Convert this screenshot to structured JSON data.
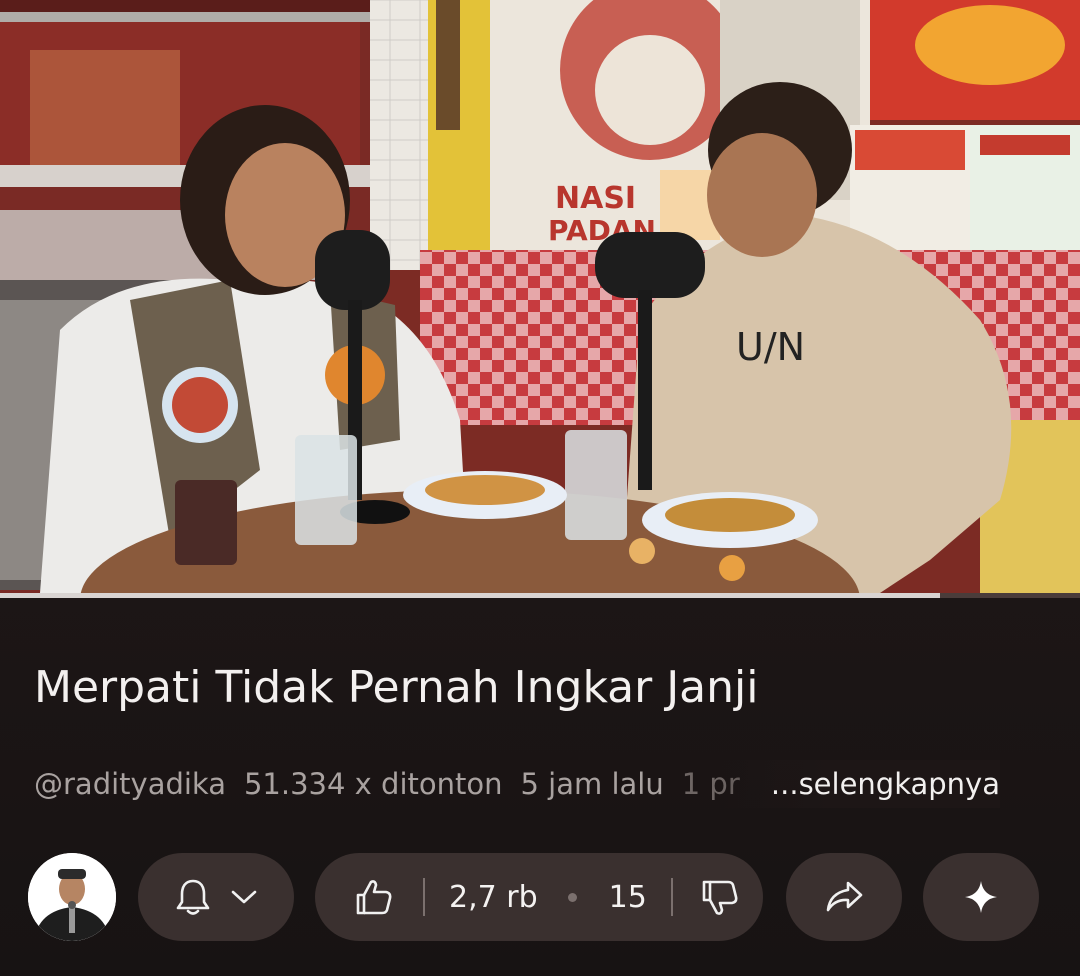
{
  "video": {
    "progress": 0.87
  },
  "title": "Merpati Tidak Pernah Ingkar Janji",
  "meta": {
    "channel": "@radityadika",
    "views": "51.334 x ditonton",
    "time": "5 jam lalu",
    "extra": "1 pr",
    "more": "...selengkapnya"
  },
  "actions": {
    "likes": "2,7 rb",
    "comments": "15"
  },
  "colors": {
    "background": "#1d1616",
    "pill": "#3a302f",
    "text": "#f3f0ef",
    "meta_text": "#a9a2a0"
  },
  "icons": [
    "bell-icon",
    "chevron-down-icon",
    "thumbs-up-icon",
    "thumbs-down-icon",
    "share-icon",
    "sparkle-icon"
  ]
}
